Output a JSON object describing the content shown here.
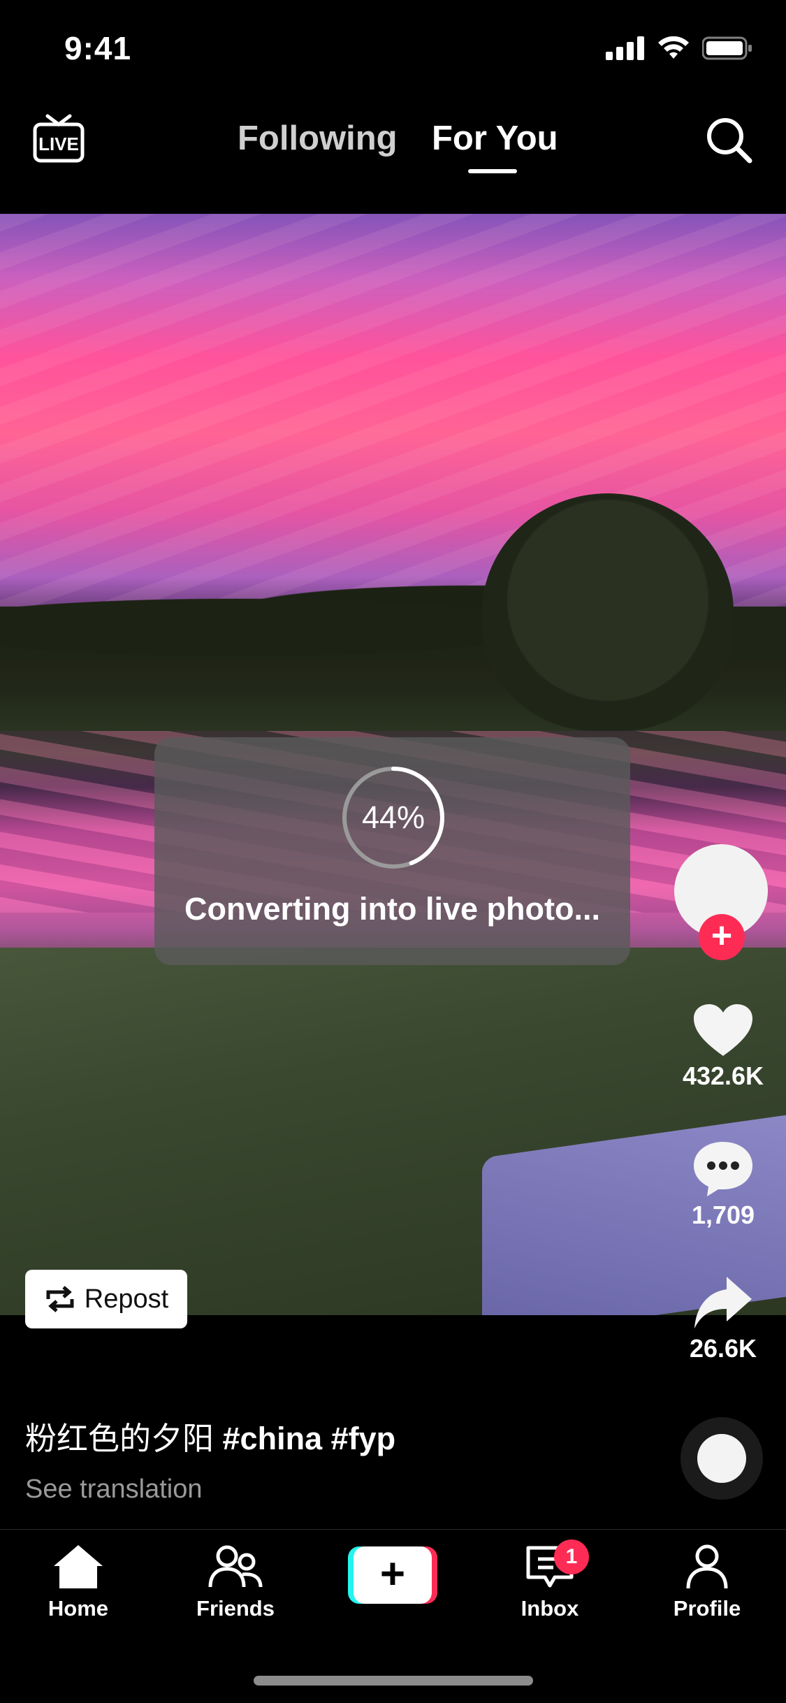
{
  "status_bar": {
    "time": "9:41"
  },
  "top_nav": {
    "live_label": "LIVE",
    "tabs": [
      {
        "label": "Following"
      },
      {
        "label": "For You"
      }
    ],
    "active_tab": "For You"
  },
  "overlay": {
    "progress_text": "44%",
    "progress_value": 0.44,
    "message": "Converting into live photo..."
  },
  "rail": {
    "likes": "432.6K",
    "comments": "1,709",
    "shares": "26.6K"
  },
  "repost": {
    "label": "Repost"
  },
  "caption": {
    "text_zh": "粉红色的夕阳",
    "hashtags": "#china #fyp",
    "see_translation": "See translation"
  },
  "bottom_nav": {
    "items": [
      {
        "label": "Home",
        "icon": "home-icon"
      },
      {
        "label": "Friends",
        "icon": "friends-icon"
      },
      {
        "label": "",
        "icon": "create-plus-icon"
      },
      {
        "label": "Inbox",
        "icon": "inbox-icon",
        "badge": "1"
      },
      {
        "label": "Profile",
        "icon": "profile-icon"
      }
    ]
  },
  "colors": {
    "accent_red": "#fe2c55",
    "accent_cyan": "#25f4ee",
    "background": "#000000"
  }
}
